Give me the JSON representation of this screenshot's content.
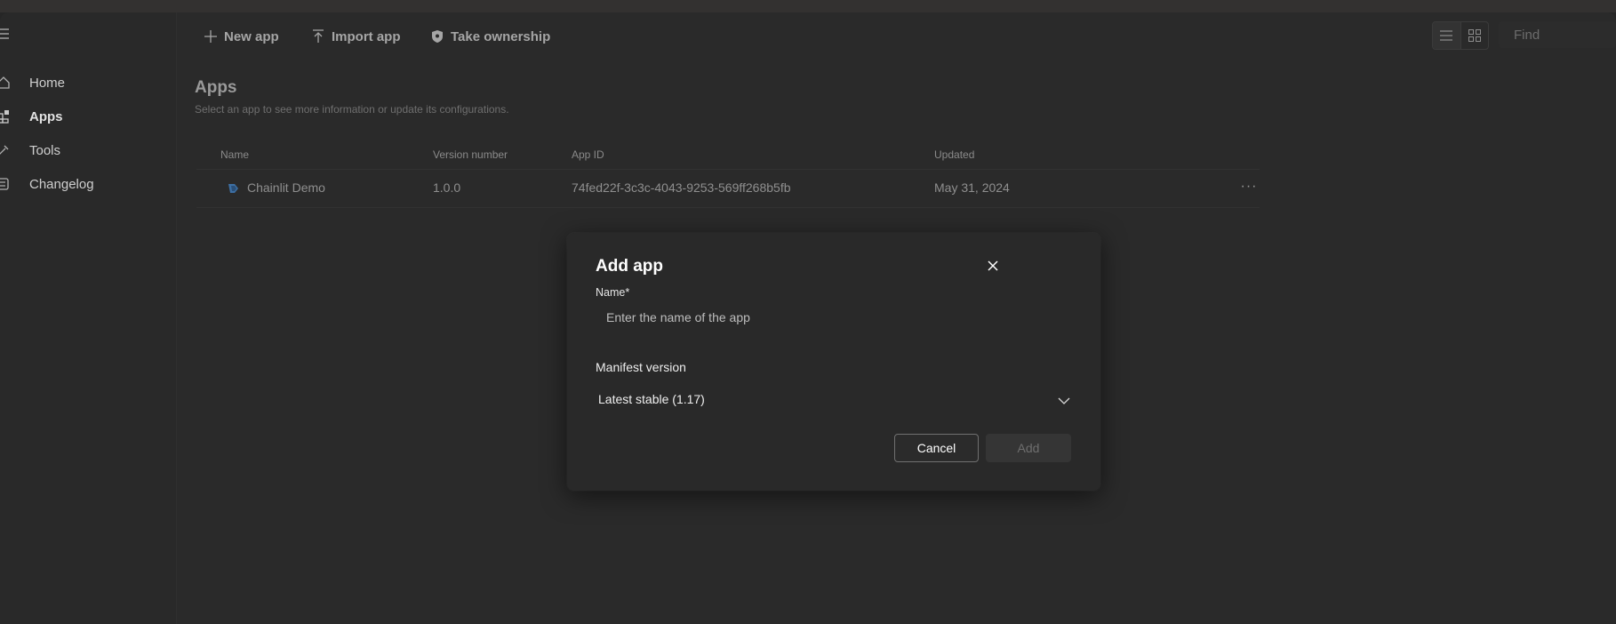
{
  "toolbar": {
    "new_app": "New app",
    "import_app": "Import app",
    "take_ownership": "Take ownership",
    "find_placeholder": "Find"
  },
  "sidebar": {
    "items": [
      {
        "label": "Home",
        "icon": "home-icon"
      },
      {
        "label": "Apps",
        "icon": "apps-icon",
        "active": true
      },
      {
        "label": "Tools",
        "icon": "tools-icon"
      },
      {
        "label": "Changelog",
        "icon": "changelog-icon"
      }
    ]
  },
  "page": {
    "title": "Apps",
    "subtitle": "Select an app to see more information or update its configurations."
  },
  "table": {
    "headers": [
      "Name",
      "Version number",
      "App ID",
      "Updated"
    ],
    "rows": [
      {
        "name": "Chainlit Demo",
        "version": "1.0.0",
        "app_id": "74fed22f-3c3c-4043-9253-569ff268b5fb",
        "updated": "May 31, 2024",
        "more": "···"
      }
    ]
  },
  "dialog": {
    "title": "Add app",
    "name_label": "Name",
    "required_mark": "*",
    "name_placeholder": "Enter the name of the app",
    "name_value": "",
    "manifest_label": "Manifest version",
    "manifest_value": "Latest stable (1.17)",
    "cancel": "Cancel",
    "add": "Add"
  },
  "colors": {
    "background": "#292929",
    "dialog_bg": "#292929",
    "text_primary": "#ffffff",
    "text_muted": "#8f8f8f"
  }
}
